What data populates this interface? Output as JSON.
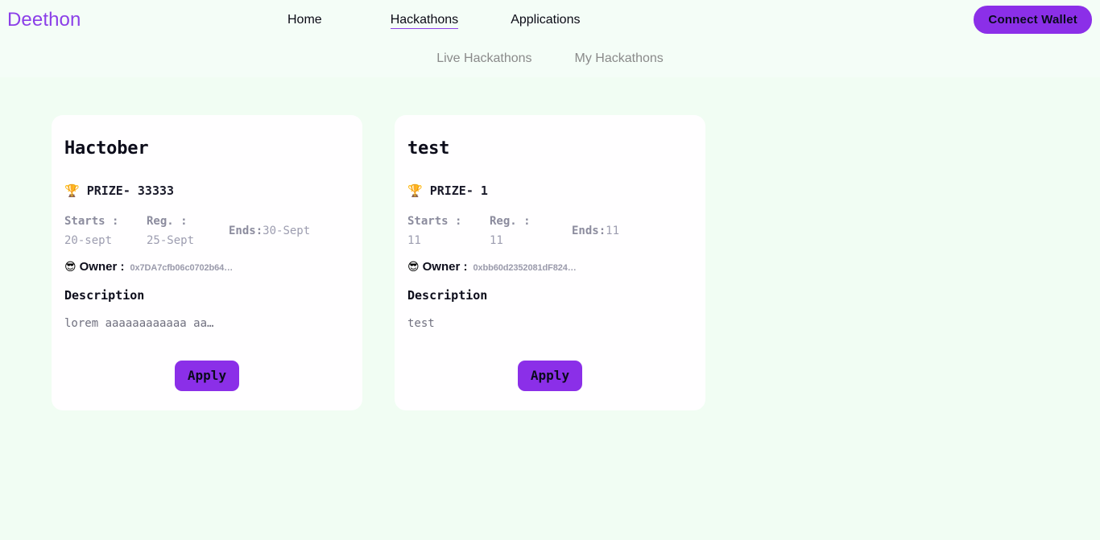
{
  "brand": {
    "name": "Deethon",
    "color": "#8b3fe8"
  },
  "header": {
    "nav": [
      {
        "label": "Home",
        "active": false
      },
      {
        "label": "Hackathons",
        "active": true
      },
      {
        "label": "Applications",
        "active": false
      }
    ],
    "wallet_button": "Connect Wallet"
  },
  "subnav": {
    "items": [
      {
        "label": "Live Hackathons"
      },
      {
        "label": "My Hackathons"
      }
    ]
  },
  "labels": {
    "prize_prefix": "PRIZE-",
    "starts": "Starts :",
    "reg": "Reg. :",
    "ends": "Ends:",
    "owner": "Owner :",
    "description": "Description",
    "apply": "Apply",
    "trophy_icon": "🏆",
    "owner_icon": "😎"
  },
  "colors": {
    "page_background": "#f1fdf3",
    "header_background": "#f4fdf7",
    "card_background": "#fffeff",
    "accent_purple": "#8b2fe8",
    "muted_text": "#9d9db0"
  },
  "cards": [
    {
      "title": "Hactober",
      "prize": "33333",
      "starts": "20-sept",
      "reg": "25-Sept",
      "ends": "30-Sept",
      "owner": "0x7DA7cfb06c0702b64…",
      "description": "lorem aaaaaaaaaaaa aa…",
      "apply": "Apply"
    },
    {
      "title": "test",
      "prize": "1",
      "starts": "11",
      "reg": "11",
      "ends": "11",
      "owner": "0xbb60d2352081dF824…",
      "description": "test",
      "apply": "Apply"
    }
  ]
}
